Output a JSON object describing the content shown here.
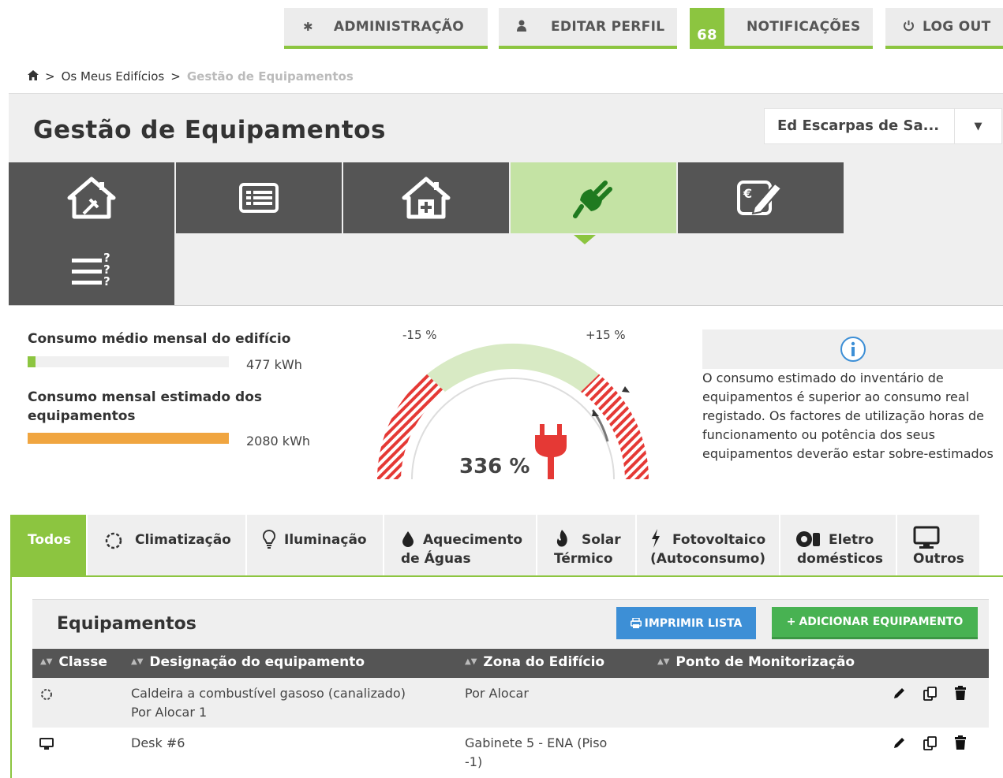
{
  "topnav": {
    "admin_label": "ADMINISTRAÇÃO",
    "edit_profile_label": "EDITAR PERFIL",
    "notifications_count": "68",
    "notifications_label": "NOTIFICAÇÕES",
    "logout_label": "LOG OUT"
  },
  "breadcrumb": {
    "item1": "Os Meus Edifícios",
    "separator": ">",
    "current": "Gestão de Equipamentos"
  },
  "page": {
    "title": "Gestão de Equipamentos",
    "building_select": "Ed Escarpas de Sa..."
  },
  "icon_tabs": [
    "house-energy-icon",
    "list-icon",
    "house-plus-icon",
    "plug-icon",
    "euro-edit-icon",
    "list-question-icon"
  ],
  "consumption": {
    "building_label": "Consumo médio mensal do edifício",
    "building_value": "477 kWh",
    "building_fill": 0.04,
    "equipment_label": "Consumo mensal estimado dos equipamentos",
    "equipment_value": "2080 kWh",
    "equipment_fill": 1.0
  },
  "gauge": {
    "left_label": "-15 %",
    "right_label": "+15 %",
    "value_label": "336 %"
  },
  "info": {
    "text": "O consumo estimado do inventário de equipamentos é superior ao consumo real registado. Os factores de utilização horas de funcionamento ou potência dos seus equipamentos deverão estar sobre-estimados"
  },
  "categories": {
    "todos": "Todos",
    "climatizacao": "Climatização",
    "iluminacao": "Iluminação",
    "aquecimento_1": "Aquecimento",
    "aquecimento_2": "de Águas",
    "solar_1": "Solar",
    "solar_2": "Térmico",
    "foto_1": "Fotovoltaico",
    "foto_2": "(Autoconsumo)",
    "eletro_1": "Eletro",
    "eletro_2": "domésticos",
    "outros": "Outros"
  },
  "equipment": {
    "title": "Equipamentos",
    "print_label": "IMPRIMIR LISTA",
    "add_label": "ADICIONAR EQUIPAMENTO",
    "columns": {
      "classe": "Classe",
      "designacao": "Designação do equipamento",
      "zona": "Zona do Edifício",
      "ponto": "Ponto de Monitorização"
    },
    "rows": [
      {
        "class_icon": "gear-icon",
        "designation_line1": "Caldeira a combustível gasoso (canalizado)",
        "designation_line2": "Por Alocar 1",
        "zone_line1": "Por Alocar",
        "zone_line2": "",
        "monitor": ""
      },
      {
        "class_icon": "monitor-icon",
        "designation_line1": "Desk #6",
        "designation_line2": "",
        "zone_line1": "Gabinete 5 - ENA (Piso",
        "zone_line2": "-1)",
        "monitor": ""
      }
    ]
  },
  "colors": {
    "accent_green": "#8cc540",
    "dark_gray": "#555555",
    "bar_orange": "#f0a540",
    "print_blue": "#3d8fd6",
    "add_green": "#48b252",
    "gauge_red": "#e53935"
  }
}
